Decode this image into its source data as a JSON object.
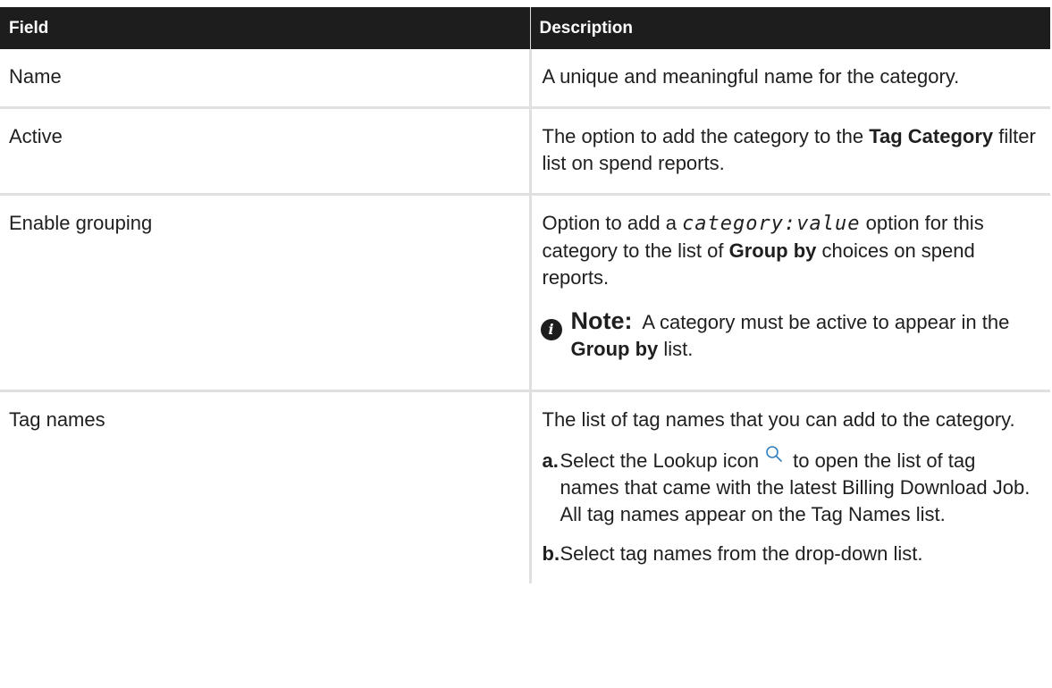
{
  "header": {
    "field": "Field",
    "description": "Description"
  },
  "rows": [
    {
      "field": "Name",
      "description": "A unique and meaningful name for the category."
    },
    {
      "field": "Active",
      "description_before": "The option to add the category to the ",
      "description_bold": "Tag Category",
      "description_after": " filter list on spend reports."
    },
    {
      "field": "Enable grouping",
      "description_before": "Option to add a ",
      "description_code": "category:value",
      "description_middle": " option for this category to the list of ",
      "description_bold": "Group by",
      "description_after": " choices on spend reports.",
      "note": {
        "icon": "info-icon",
        "label": "Note:",
        "text_before": " A category must be active to appear in the ",
        "text_bold": "Group by",
        "text_after": " list."
      }
    },
    {
      "field": "Tag names",
      "description": "The list of tag names that you can add to the category.",
      "steps": [
        {
          "letter": "a.",
          "text_before": "Select the Lookup icon",
          "icon": "search-icon",
          "text_after": "to open the list of tag names that came with the latest Billing Download Job. All tag names appear on the Tag Names list."
        },
        {
          "letter": "b.",
          "text": "Select tag names from the drop-down list."
        }
      ]
    }
  ],
  "colors": {
    "header_bg": "#1d1d1d",
    "header_text": "#ffffff",
    "border": "#e0e0e0",
    "icon_blue": "#2f7fc1"
  }
}
